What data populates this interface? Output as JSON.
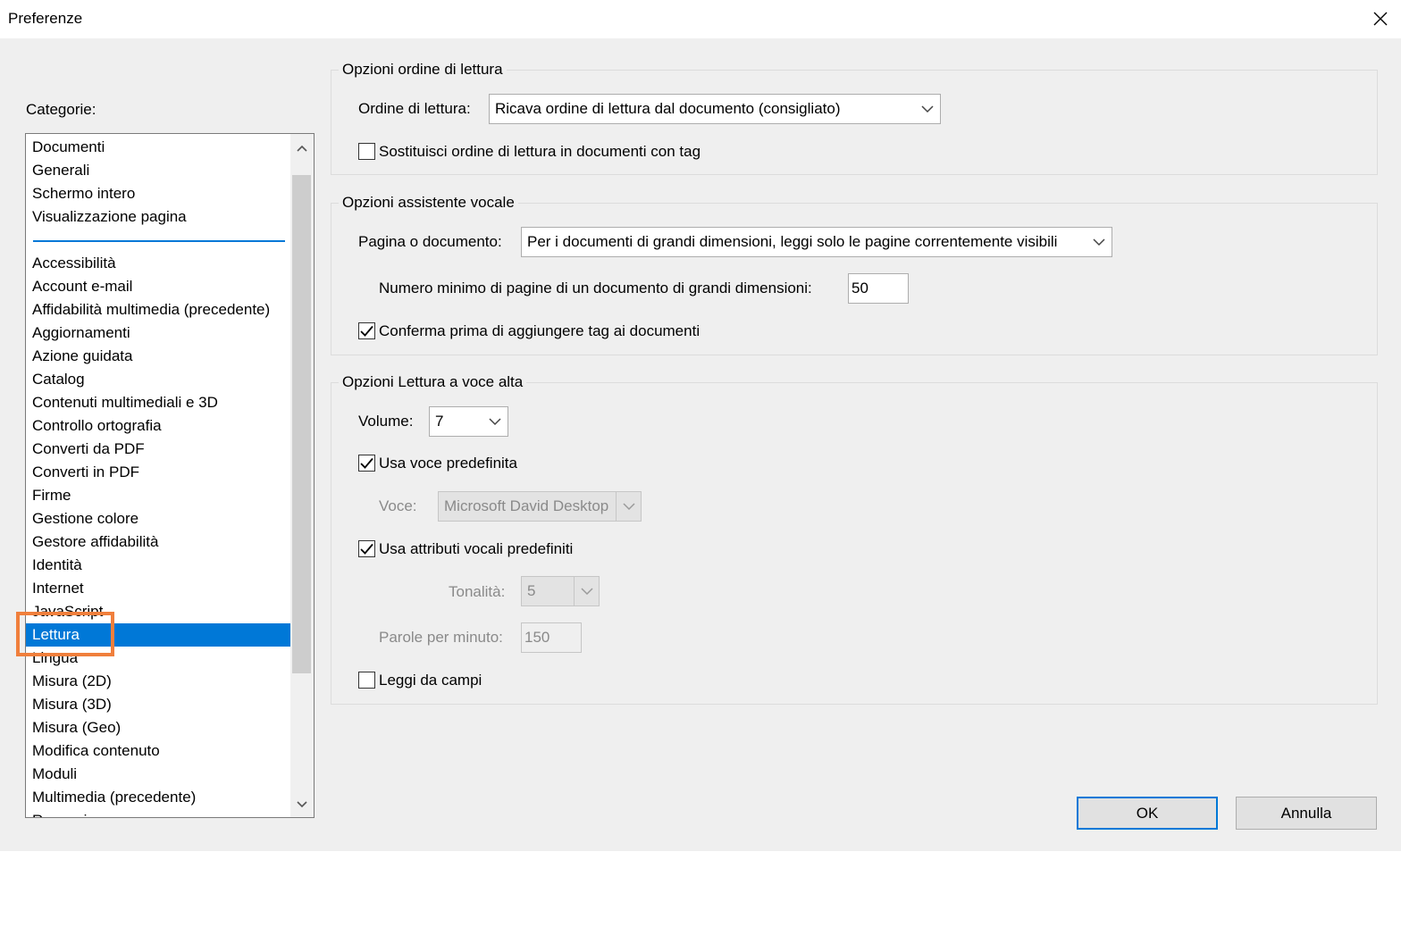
{
  "window": {
    "title": "Preferenze"
  },
  "categories": {
    "label": "Categorie:",
    "top_items": [
      "Documenti",
      "Generali",
      "Schermo intero",
      "Visualizzazione pagina"
    ],
    "items": [
      "Accessibilità",
      "Account e-mail",
      "Affidabilità multimedia (precedente)",
      "Aggiornamenti",
      "Azione guidata",
      "Catalog",
      "Contenuti multimediali e 3D",
      "Controllo ortografia",
      "Converti da PDF",
      "Converti in PDF",
      "Firme",
      "Gestione colore",
      "Gestore affidabilità",
      "Identità",
      "Internet",
      "JavaScript",
      "Lettura",
      "Lingua",
      "Misura (2D)",
      "Misura (3D)",
      "Misura (Geo)",
      "Modifica contenuto",
      "Moduli",
      "Multimedia (precedente)",
      "Recensione"
    ],
    "selected": "Lettura"
  },
  "reading_order": {
    "legend": "Opzioni ordine di lettura",
    "order_label": "Ordine di lettura:",
    "order_value": "Ricava ordine di lettura dal documento (consigliato)",
    "override_label": "Sostituisci ordine di lettura in documenti con tag",
    "override_checked": false
  },
  "screen_reader": {
    "legend": "Opzioni assistente vocale",
    "page_label": "Pagina o documento:",
    "page_value": "Per i documenti di grandi dimensioni, leggi solo le pagine correntemente visibili",
    "min_pages_label": "Numero minimo di pagine di un documento di grandi dimensioni:",
    "min_pages_value": "50",
    "confirm_tag_label": "Conferma prima di aggiungere tag ai documenti",
    "confirm_tag_checked": true
  },
  "read_aloud": {
    "legend": "Opzioni Lettura a voce alta",
    "volume_label": "Volume:",
    "volume_value": "7",
    "default_voice_label": "Usa voce predefinita",
    "default_voice_checked": true,
    "voice_label": "Voce:",
    "voice_value": "Microsoft David Desktop",
    "default_attrs_label": "Usa attributi vocali predefiniti",
    "default_attrs_checked": true,
    "pitch_label": "Tonalità:",
    "pitch_value": "5",
    "wpm_label": "Parole per minuto:",
    "wpm_value": "150",
    "read_fields_label": "Leggi da campi",
    "read_fields_checked": false
  },
  "buttons": {
    "ok": "OK",
    "cancel": "Annulla"
  },
  "colors": {
    "selection": "#0078d7",
    "highlight": "#f07f3c",
    "dialog_bg": "#efefef"
  }
}
